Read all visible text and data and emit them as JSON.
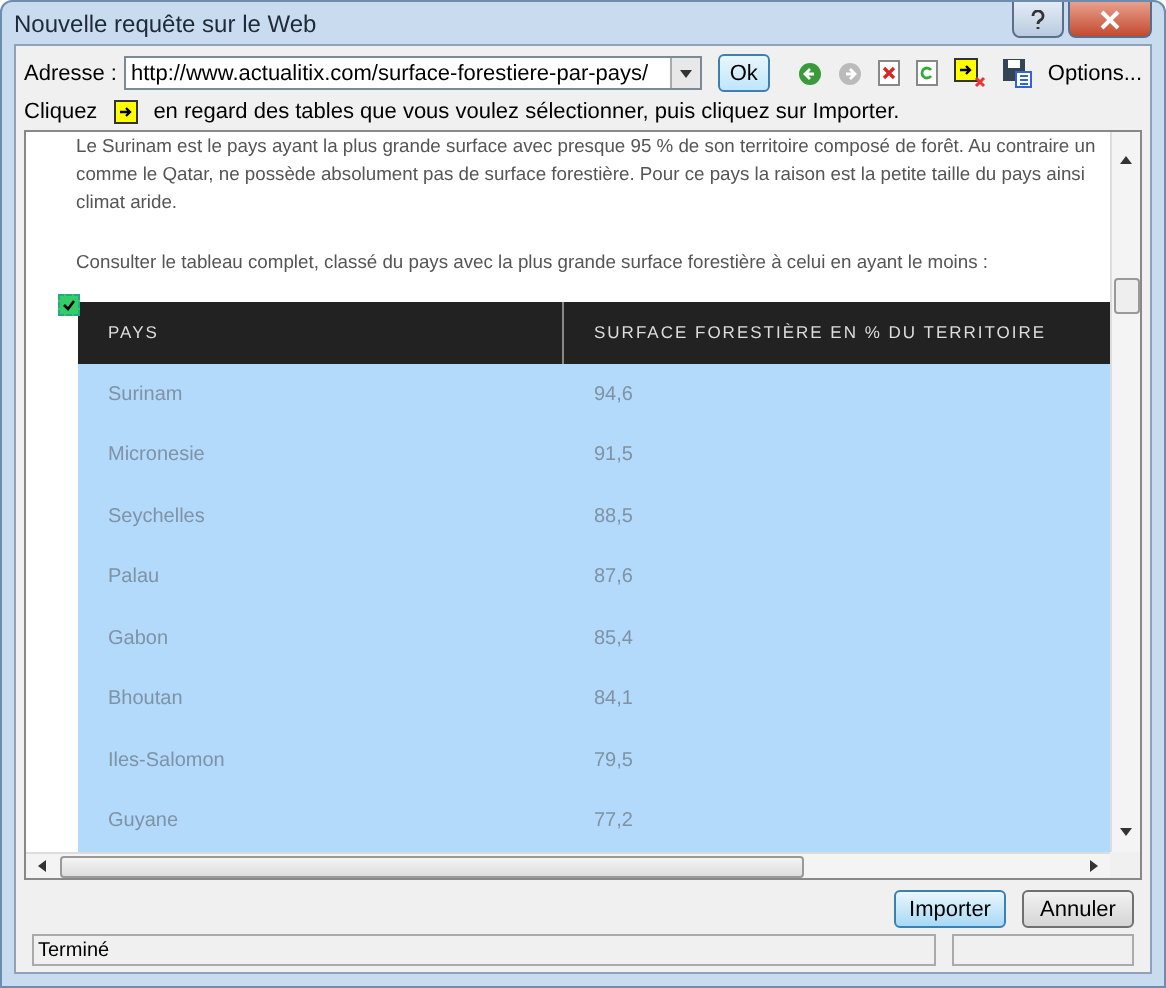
{
  "window": {
    "title": "Nouvelle requête sur le Web"
  },
  "address": {
    "label": "Adresse :",
    "value": "http://www.actualitix.com/surface-forestiere-par-pays/",
    "go": "Ok",
    "options": "Options..."
  },
  "instruction": {
    "before": "Cliquez",
    "after": "en regard des tables que vous voulez sélectionner, puis cliquez sur Importer."
  },
  "page": {
    "paragraph": [
      "Le Surinam est le pays ayant la plus grande surface avec presque 95 % de son territoire composé de forêt. Au contraire un",
      "comme le Qatar, ne possède absolument pas de surface forestière. Pour ce pays la raison est la petite taille du pays ainsi",
      "climat aride."
    ],
    "intro": "Consulter le tableau complet, classé du pays avec la plus grande surface forestière à celui en ayant le moins :",
    "table": {
      "selected": true,
      "columns": [
        "PAYS",
        "SURFACE FORESTIÈRE EN % DU TERRITOIRE"
      ],
      "rows": [
        [
          "Surinam",
          "94,6"
        ],
        [
          "Micronesie",
          "91,5"
        ],
        [
          "Seychelles",
          "88,5"
        ],
        [
          "Palau",
          "87,6"
        ],
        [
          "Gabon",
          "85,4"
        ],
        [
          "Bhoutan",
          "84,1"
        ],
        [
          "Iles-Salomon",
          "79,5"
        ],
        [
          "Guyane",
          "77,2"
        ]
      ]
    }
  },
  "buttons": [
    {
      "label": "Importer",
      "focused": true
    },
    {
      "label": "Annuler",
      "focused": false
    }
  ],
  "status_bar": {
    "text": "Terminé"
  }
}
